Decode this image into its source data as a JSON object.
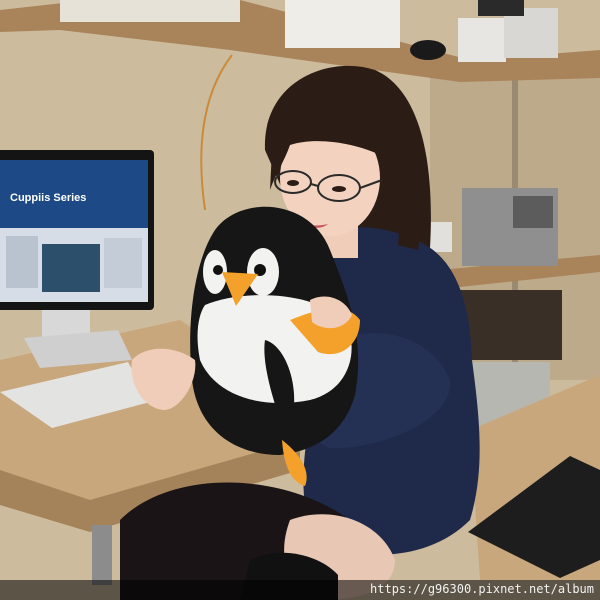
{
  "monitor": {
    "screen_heading": "Cuppiis Series"
  },
  "watermark": {
    "text": "https://g96300.pixnet.net/album"
  },
  "colors": {
    "wall": "#cdbb9e",
    "shelf": "#a98359",
    "desk": "#c9a77c",
    "jacket": "#1f2a4a",
    "penguin_black": "#161616",
    "penguin_beak": "#f3a12a",
    "monitor_blue": "#1d4a86"
  }
}
